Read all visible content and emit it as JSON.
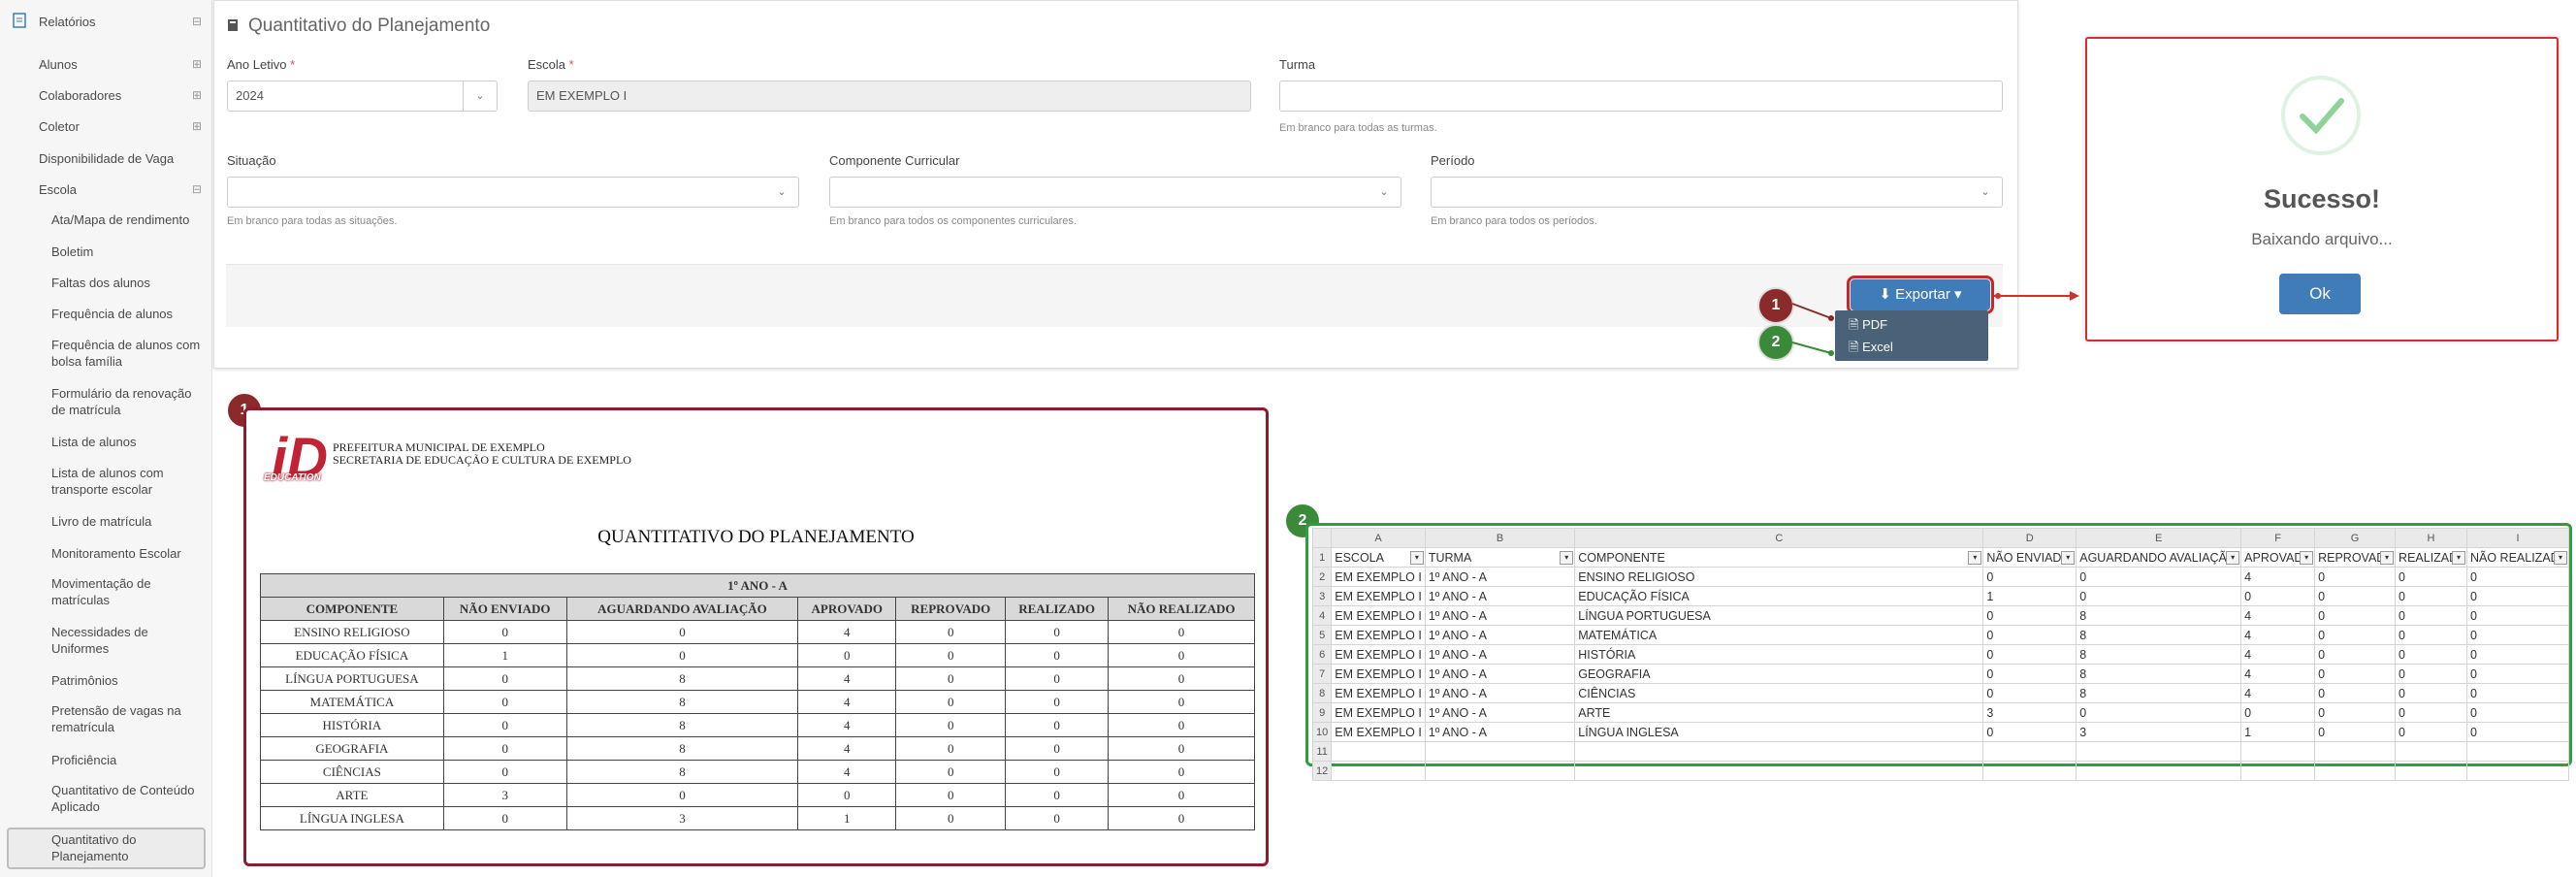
{
  "sidebar": {
    "top_item": "Relatórios",
    "l1_items": [
      "Alunos",
      "Colaboradores",
      "Coletor",
      "Disponibilidade de Vaga",
      "Escola"
    ],
    "l1_toggles": [
      "⊟",
      "⊞",
      "⊞",
      "⊞",
      "",
      "⊟"
    ],
    "escola_items": [
      "Ata/Mapa de rendimento",
      "Boletim",
      "Faltas dos alunos",
      "Frequência de alunos",
      "Frequência de alunos com bolsa família",
      "Formulário da renovação de matrícula",
      "Lista de alunos",
      "Lista de alunos com transporte escolar",
      "Livro de matrícula",
      "Monitoramento Escolar",
      "Movimentação de matrículas",
      "Necessidades de Uniformes",
      "Patrimônios",
      "Pretensão de vagas na rematrícula",
      "Proficiência",
      "Quantitativo de Conteúdo Aplicado",
      "Quantitativo do Planejamento"
    ]
  },
  "form": {
    "title": "Quantitativo do Planejamento",
    "ano_label": "Ano Letivo",
    "ano_value": "2024",
    "escola_label": "Escola",
    "escola_value": "EM EXEMPLO I",
    "turma_label": "Turma",
    "turma_hint": "Em branco para todas as turmas.",
    "situacao_label": "Situação",
    "situacao_hint": "Em branco para todas as situações.",
    "componente_label": "Componente Curricular",
    "componente_hint": "Em branco para todos os componentes curriculares.",
    "periodo_label": "Período",
    "periodo_hint": "Em branco para todos os períodos.",
    "required_mark": "*"
  },
  "export": {
    "button_label": "Exportar",
    "menu": [
      "PDF",
      "Excel"
    ],
    "badges": [
      "1",
      "2"
    ]
  },
  "success": {
    "title": "Sucesso!",
    "message": "Baixando arquivo...",
    "ok_label": "Ok"
  },
  "pdf": {
    "badge": "1",
    "logo_text": "EDUCATION",
    "logo_mark": "iD",
    "header_line1": "PREFEITURA MUNICIPAL DE EXEMPLO",
    "header_line2": "SECRETARIA DE EDUCAÇÃO E CULTURA DE EXEMPLO",
    "title": "QUANTITATIVO DO PLANEJAMENTO",
    "group": "1º ANO - A",
    "columns": [
      "COMPONENTE",
      "NÃO ENVIADO",
      "AGUARDANDO AVALIAÇÃO",
      "APROVADO",
      "REPROVADO",
      "REALIZADO",
      "NÃO REALIZADO"
    ],
    "rows": [
      [
        "ENSINO RELIGIOSO",
        "0",
        "0",
        "4",
        "0",
        "0",
        "0"
      ],
      [
        "EDUCAÇÃO FÍSICA",
        "1",
        "0",
        "0",
        "0",
        "0",
        "0"
      ],
      [
        "LÍNGUA PORTUGUESA",
        "0",
        "8",
        "4",
        "0",
        "0",
        "0"
      ],
      [
        "MATEMÁTICA",
        "0",
        "8",
        "4",
        "0",
        "0",
        "0"
      ],
      [
        "HISTÓRIA",
        "0",
        "8",
        "4",
        "0",
        "0",
        "0"
      ],
      [
        "GEOGRAFIA",
        "0",
        "8",
        "4",
        "0",
        "0",
        "0"
      ],
      [
        "CIÊNCIAS",
        "0",
        "8",
        "4",
        "0",
        "0",
        "0"
      ],
      [
        "ARTE",
        "3",
        "0",
        "0",
        "0",
        "0",
        "0"
      ],
      [
        "LÍNGUA INGLESA",
        "0",
        "3",
        "1",
        "0",
        "0",
        "0"
      ]
    ]
  },
  "excel": {
    "badge": "2",
    "col_letters": [
      "A",
      "B",
      "C",
      "D",
      "E",
      "F",
      "G",
      "H",
      "I"
    ],
    "headers": [
      "ESCOLA",
      "TURMA",
      "COMPONENTE",
      "NÃO ENVIAD",
      "AGUARDANDO AVALIAÇÃ",
      "APROVAD",
      "REPROVAD",
      "REALIZAD",
      "NÃO REALIZAD"
    ],
    "rows": [
      [
        "EM EXEMPLO I",
        "1º ANO - A",
        "ENSINO RELIGIOSO",
        "0",
        "0",
        "4",
        "0",
        "0",
        "0"
      ],
      [
        "EM EXEMPLO I",
        "1º ANO - A",
        "EDUCAÇÃO FÍSICA",
        "1",
        "0",
        "0",
        "0",
        "0",
        "0"
      ],
      [
        "EM EXEMPLO I",
        "1º ANO - A",
        "LÍNGUA PORTUGUESA",
        "0",
        "8",
        "4",
        "0",
        "0",
        "0"
      ],
      [
        "EM EXEMPLO I",
        "1º ANO - A",
        "MATEMÁTICA",
        "0",
        "8",
        "4",
        "0",
        "0",
        "0"
      ],
      [
        "EM EXEMPLO I",
        "1º ANO - A",
        "HISTÓRIA",
        "0",
        "8",
        "4",
        "0",
        "0",
        "0"
      ],
      [
        "EM EXEMPLO I",
        "1º ANO - A",
        "GEOGRAFIA",
        "0",
        "8",
        "4",
        "0",
        "0",
        "0"
      ],
      [
        "EM EXEMPLO I",
        "1º ANO - A",
        "CIÊNCIAS",
        "0",
        "8",
        "4",
        "0",
        "0",
        "0"
      ],
      [
        "EM EXEMPLO I",
        "1º ANO - A",
        "ARTE",
        "3",
        "0",
        "0",
        "0",
        "0",
        "0"
      ],
      [
        "EM EXEMPLO I",
        "1º ANO - A",
        "LÍNGUA INGLESA",
        "0",
        "3",
        "1",
        "0",
        "0",
        "0"
      ]
    ],
    "row_numbers": [
      "1",
      "2",
      "3",
      "4",
      "5",
      "6",
      "7",
      "8",
      "9",
      "10",
      "11",
      "12"
    ],
    "filter_glyph": "▾"
  },
  "colors": {
    "brand": "#3f7cb8",
    "danger": "#d32f2f",
    "pdf_border": "#8b1e2b",
    "excel_border": "#2e9e3e",
    "success": "#8fd39a"
  }
}
